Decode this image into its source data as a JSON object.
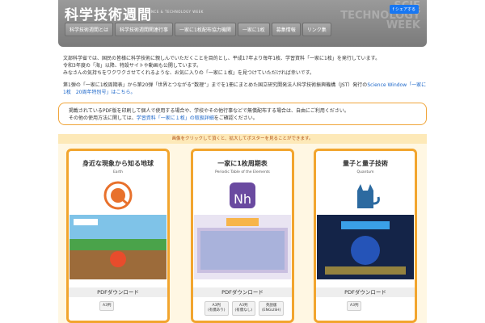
{
  "header": {
    "logo": "科学技術週間",
    "logo_sub": "SCIENCE & TECHNOLOGY WEEK",
    "watermark": [
      "SCIE",
      "TECHNOLOGY",
      "WEEK"
    ],
    "share": "シェアする",
    "nav": [
      "科学技術週間とは",
      "科学技術週間関連行事",
      "一家に1枚配布協力機関",
      "一家に1枚",
      "募集情報",
      "リンク集"
    ]
  },
  "intro": {
    "p1": "文部科学省では、国民の皆様に科学技術に親しんでいただくことを目的とし、平成17年より毎年1枚、学習資料「一家に1枚」を発行しています。",
    "p2": "令和3年度の「海」以降、特設サイトや動画も公開しています。",
    "p3": "みなさんの気持ちをワクワクさせてくれるような、お気に入りの「一家に１枚」を見つけていただければ幸いです。",
    "p4a": "第1弾の「一家に1枚周期表」から第20弾「世界とつながる“数理”」までを1冊にまとめた国立研究開発法人科学技術振興機構（JST）発行の",
    "p4link": "Science Window「一家に1枚　20周年特別号」はこちら。"
  },
  "notice": {
    "line1": "掲載されているPDF版を印刷して個人で使用する場合や、学校やその他行事などで無償配布する場合は、自由にご利用ください。",
    "line2a": "その他の使用方法に関しては、",
    "line2link": "学習資料「一家に１枚」の取扱詳細",
    "line2b": "をご確認ください。"
  },
  "band": "画像をクリックして頂くと、拡大してポスターを見ることができます。",
  "cards": [
    {
      "title": "身近な現象から知る地球",
      "sub": "Earth",
      "pdf": "PDFダウンロード",
      "buttons": [
        "A3判"
      ]
    },
    {
      "title": "一家に1枚周期表",
      "sub": "Periodic Table of the Elements",
      "pdf": "PDFダウンロード",
      "buttons": [
        "A3判\n(有償あり)",
        "A3判\n(有償なし)",
        "英語版\n(ENGLISH)"
      ]
    },
    {
      "title": "量子と量子技術",
      "sub": "Quantum",
      "pdf": "PDFダウンロード",
      "buttons": [
        "A3判"
      ]
    }
  ],
  "colors": {
    "accent": "#f2a52e",
    "link": "#1b66c9",
    "band": "#fde9b8"
  }
}
